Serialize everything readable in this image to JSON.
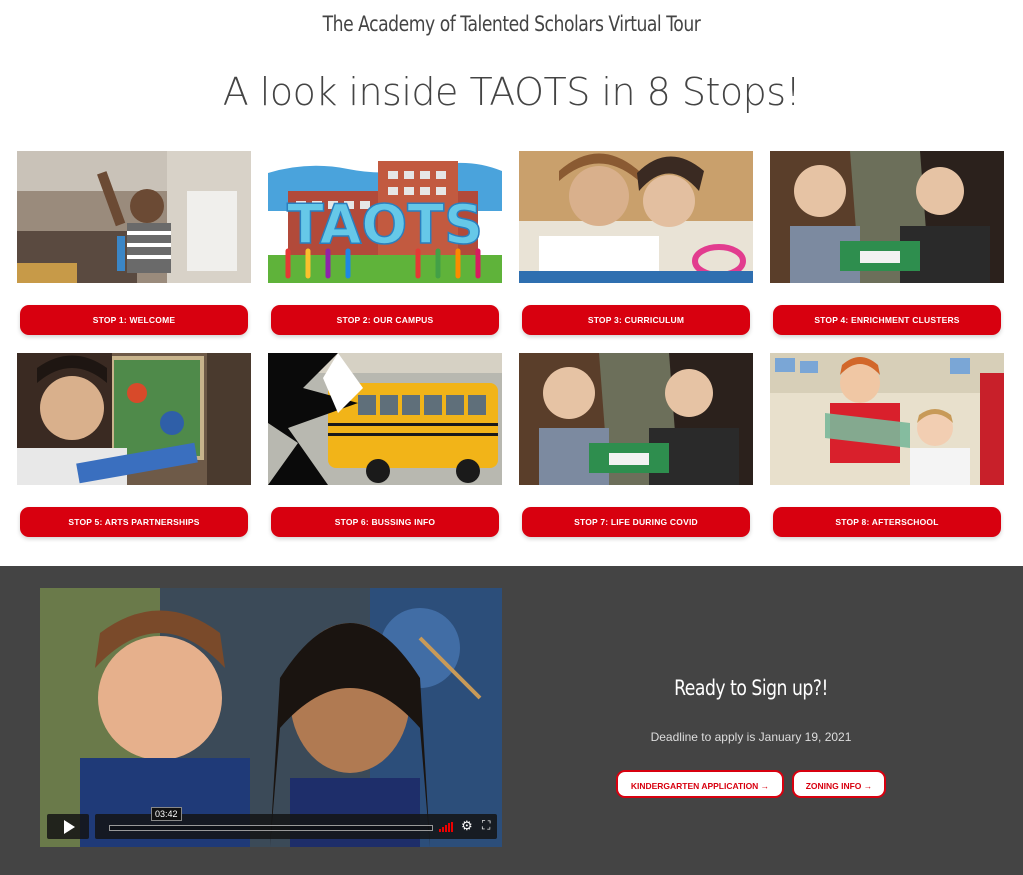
{
  "header": {
    "subtitle": "The Academy of Talented Scholars Virtual Tour",
    "headline": "A look inside TAOTS in 8 Stops!"
  },
  "stops": [
    {
      "label": "STOP 1: WELCOME",
      "image": "child-waving-photo"
    },
    {
      "label": "STOP 2: OUR CAMPUS",
      "image": "campus-illustration",
      "illustration_text": "TAOTS"
    },
    {
      "label": "STOP 3: CURRICULUM",
      "image": "students-reading-photo"
    },
    {
      "label": "STOP 4: ENRICHMENT CLUSTERS",
      "image": "students-crafting-photo"
    },
    {
      "label": "STOP 5: ARTS PARTNERSHIPS",
      "image": "child-painting-photo"
    },
    {
      "label": "STOP 6: BUSSING INFO",
      "image": "school-bus-photo"
    },
    {
      "label": "STOP 7: LIFE DURING COVID",
      "image": "students-crafting-photo"
    },
    {
      "label": "STOP 8: AFTERSCHOOL",
      "image": "children-classroom-photo"
    }
  ],
  "video": {
    "timecode": "03:42",
    "progress": 0,
    "icons": [
      "play-icon",
      "volume-icon",
      "settings-gear-icon",
      "fullscreen-icon"
    ]
  },
  "signup": {
    "title": "Ready to Sign up?!",
    "deadline": "Deadline to apply is January 19, 2021",
    "kindergarten_label": "KINDERGARTEN APPLICATION →",
    "zoning_label": "ZONING INFO →"
  },
  "colors": {
    "accent_red": "#d8000f",
    "dark_band": "#444444",
    "heading_text": "#444444"
  }
}
